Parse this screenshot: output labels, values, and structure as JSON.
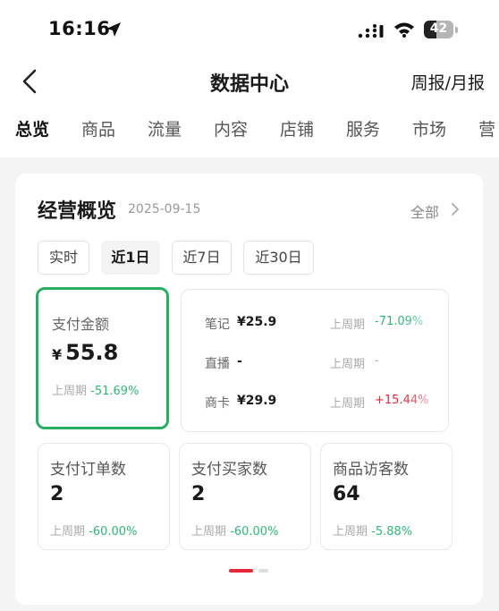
{
  "status_bar": {
    "time": "16:16",
    "battery": "42",
    "battery_level": 0.42
  },
  "nav": {
    "title": "数据中心",
    "report_link": "周报/月报"
  },
  "tabs": [
    "总览",
    "商品",
    "流量",
    "内容",
    "店铺",
    "服务",
    "市场",
    "营"
  ],
  "active_tab": 0,
  "overview": {
    "title": "经营概览",
    "date": "2025-09-15",
    "all_link": "全部",
    "time_filters": [
      "实时",
      "近1日",
      "近7日",
      "近30日"
    ],
    "active_filter": 1
  },
  "main_metric": {
    "label": "支付金额",
    "currency": "¥",
    "value": "55.8",
    "prev_label": "上周期",
    "change": "-51.69%"
  },
  "breakdown": [
    {
      "name": "笔记",
      "value": "¥25.9",
      "prev_label": "上周期",
      "change": "-71.09%",
      "trend": "down"
    },
    {
      "name": "直播",
      "value": "-",
      "prev_label": "上周期",
      "change": "-",
      "trend": "none"
    },
    {
      "name": "商卡",
      "value": "¥29.9",
      "prev_label": "上周期",
      "change": "+15.44%",
      "trend": "up"
    }
  ],
  "metrics": [
    {
      "label": "支付订单数",
      "value": "2",
      "prev_label": "上周期",
      "change": "-60.00%"
    },
    {
      "label": "支付买家数",
      "value": "2",
      "prev_label": "上周期",
      "change": "-60.00%"
    },
    {
      "label": "商品访客数",
      "value": "64",
      "prev_label": "上周期",
      "change": "-5.88%"
    }
  ],
  "colors": {
    "accent_green": "#27ae60",
    "down_green": "#2fb77a",
    "up_red": "#e6263a",
    "background_gray": "#f4f4f4"
  },
  "icons": [
    "location-arrow-icon",
    "cellular-signal-icon",
    "wifi-icon",
    "battery-icon",
    "back-chevron-icon",
    "chevron-right-icon"
  ]
}
